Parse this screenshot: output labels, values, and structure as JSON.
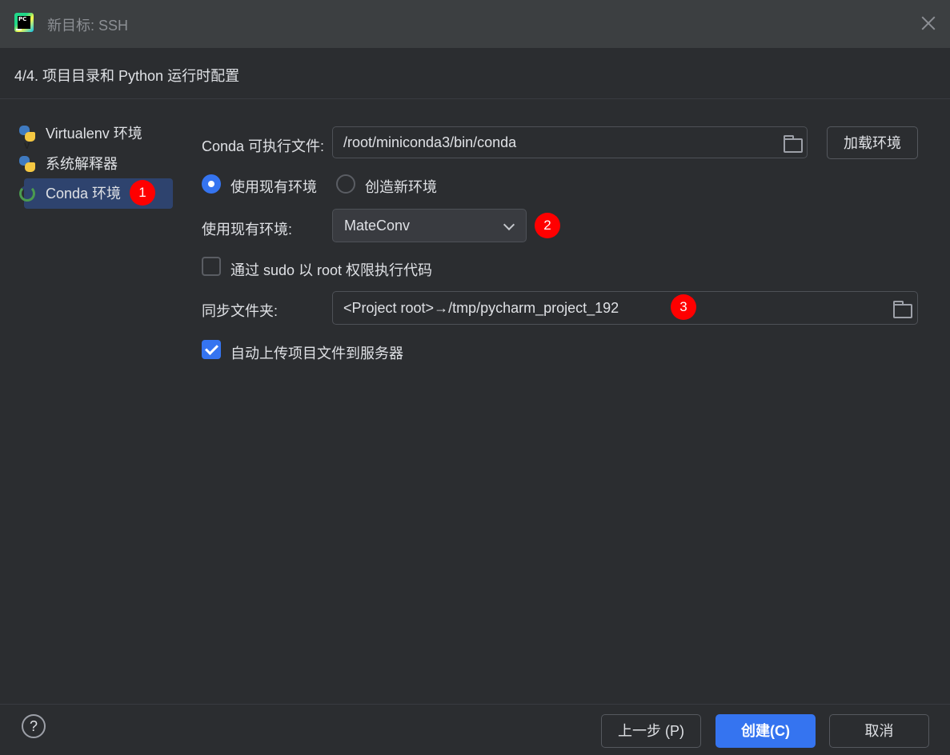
{
  "window": {
    "title": "新目标: SSH",
    "app_icon_text": "PC"
  },
  "step": {
    "title": "4/4. 项目目录和 Python 运行时配置"
  },
  "sidebar": {
    "items": [
      {
        "label": "Virtualenv 环境",
        "icon": "python-venv-icon",
        "selected": false
      },
      {
        "label": "系统解释器",
        "icon": "python-icon",
        "selected": false
      },
      {
        "label": "Conda 环境",
        "icon": "conda-icon",
        "selected": true
      }
    ]
  },
  "badges": [
    "1",
    "2",
    "3"
  ],
  "conda": {
    "label": "Conda 可执行文件:",
    "path": "/root/miniconda3/bin/conda",
    "load_button": "加载环境"
  },
  "env_mode": {
    "use_existing": "使用现有环境",
    "create_new": "创造新环境",
    "selected": "use_existing"
  },
  "existing_env": {
    "label": "使用现有环境:",
    "value": "MateConv"
  },
  "sudo": {
    "label": "通过 sudo 以 root 权限执行代码",
    "checked": false
  },
  "sync": {
    "label": "同步文件夹:",
    "value": "<Project root>→/tmp/pycharm_project_192"
  },
  "auto_upload": {
    "label": "自动上传项目文件到服务器",
    "checked": true
  },
  "footer": {
    "help": "?",
    "prev_button": "上一步 (P)",
    "create_button": "创建(C)",
    "cancel_button": "取消"
  },
  "colors": {
    "accent": "#3574f0",
    "badge": "#ff0000",
    "background": "#2b2d30",
    "selection": "#2e436e"
  }
}
